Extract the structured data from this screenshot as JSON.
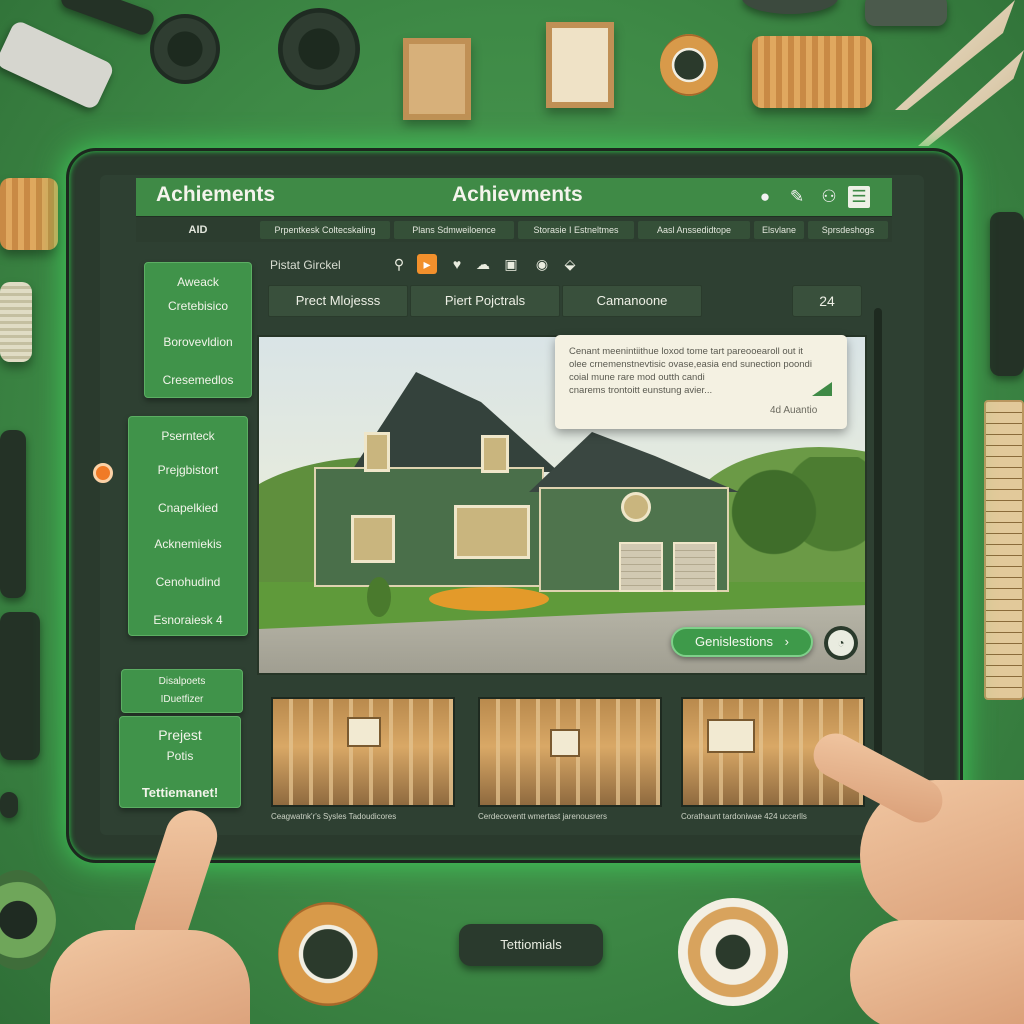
{
  "window": {
    "title_left": "Achiements",
    "title_center": "Achievments",
    "icons": [
      "record-icon",
      "pin-icon",
      "people-icon",
      "menu-icon"
    ]
  },
  "tabs": [
    "AID",
    "Prpentkesk Coltecskaling",
    "Plans Sdmweiloence",
    "Storasie I Estneltmes",
    "Aasl Anssedidtope",
    "Elsvlane",
    "Sprsdeshogs"
  ],
  "sidebar": {
    "group1": [
      "Aweack",
      "Cretebisico",
      "Borovevldion",
      "Cresemedlos"
    ],
    "group2": [
      "Psernteck",
      "Prejgbistort",
      "Cnapelkied",
      "Acknemiekis",
      "Cenohudind",
      "Esnoraiesk 4"
    ],
    "group3": [
      "Disalpoets",
      "IDuetfizer"
    ],
    "group4": [
      "Prejest",
      "Potis",
      "Tettiemanet!"
    ]
  },
  "filter": {
    "label": "Pistat Girckel",
    "icons": [
      "search-icon",
      "flag-icon",
      "heart-icon",
      "cloud-icon",
      "image-icon",
      "eye-icon",
      "tag-icon"
    ]
  },
  "segments": [
    "Prect Mlojesss",
    "Piert Pojctrals",
    "Camanoone"
  ],
  "count": "24",
  "callout": {
    "lines": [
      "Cenant meenintiithue loxod tome tart pareooearoll out it",
      "olee crnemenstnevtisic ovase,easia end sunection poondi",
      "coial mune rare mod outth candi",
      "cnarems trontoitt eunstung avier..."
    ],
    "meta": "4d  Auantio"
  },
  "cta": {
    "label": "Genislestions",
    "arrow": "›"
  },
  "thumb_captions": [
    "Ceagwatnk'r's Sysles Tadoudicores",
    "Cerdecoventt wmertast jarenousrers",
    "Corathaunt tardoniwae 424 uccerlls"
  ],
  "bottom_button": "Tettiomials",
  "colors": {
    "accent": "#3f8a46",
    "panel": "#2e4032",
    "orange": "#f2902c",
    "glow": "#3ecf5a"
  }
}
